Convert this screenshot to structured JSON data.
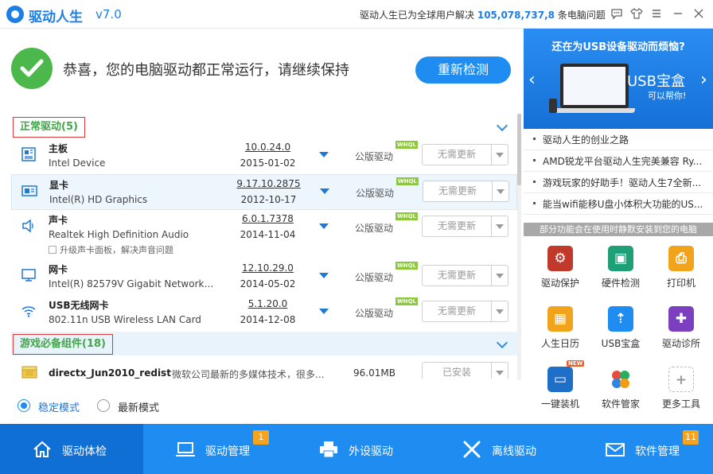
{
  "app": {
    "name": "驱动人生",
    "version": "v7.0",
    "stat_prefix": "驱动人生已为全球用户解决",
    "stat_count": "105,078,737,8",
    "stat_suffix": "条电脑问题"
  },
  "status": {
    "message": "恭喜，您的电脑驱动都正常运行，请继续保持",
    "recheck_label": "重新检测"
  },
  "sections": {
    "normal_title": "正常驱动(5)",
    "game_title": "游戏必备组件(18)"
  },
  "drivers": [
    {
      "name": "主板",
      "device": "Intel Device",
      "version": "10.0.24.0",
      "date": "2015-01-02",
      "type": "公版驱动",
      "certified": "WHQL",
      "action": "无需更新"
    },
    {
      "name": "显卡",
      "device": "Intel(R) HD Graphics",
      "version": "9.17.10.2875",
      "date": "2012-10-17",
      "type": "公版驱动",
      "certified": "WHQL",
      "action": "无需更新"
    },
    {
      "name": "声卡",
      "device": "Realtek High Definition Audio",
      "version": "6.0.1.7378",
      "date": "2014-11-04",
      "type": "公版驱动",
      "certified": "WHQL",
      "action": "无需更新",
      "extra": "升级声卡面板，解决声音问题"
    },
    {
      "name": "网卡",
      "device": "Intel(R) 82579V Gigabit Network ...",
      "version": "12.10.29.0",
      "date": "2014-05-02",
      "type": "公版驱动",
      "certified": "WHQL",
      "action": "无需更新"
    },
    {
      "name": "USB无线网卡",
      "device": "802.11n USB Wireless LAN Card",
      "version": "5.1.20.0",
      "date": "2014-12-08",
      "type": "公版驱动",
      "certified": "WHQL",
      "action": "无需更新"
    }
  ],
  "components": [
    {
      "name": "directx_Jun2010_redist",
      "description": "微软公司最新的多媒体技术，很多...",
      "size": "96.01MB",
      "action": "已安装"
    }
  ],
  "modes": {
    "stable": "稳定模式",
    "latest": "最新模式",
    "selected": "stable"
  },
  "banner": {
    "title": "还在为USB设备驱动而烦恼?",
    "main": "USB宝盒",
    "sub": "可以帮你!"
  },
  "news": [
    "驱动人生的创业之路",
    "AMD锐龙平台驱动人生完美兼容 Ry...",
    "游戏玩家的好助手！驱动人生7全新...",
    "能当wifi能移U盘小体积大功能的US..."
  ],
  "notice": "部分功能会在使用时静默安装到您的电脑",
  "tools": [
    {
      "label": "驱动保护",
      "icon": "shield-gear-icon",
      "color": "#c0392b"
    },
    {
      "label": "硬件检测",
      "icon": "monitor-check-icon",
      "color": "#1e9f76"
    },
    {
      "label": "打印机",
      "icon": "printer-icon",
      "color": "#f2a31c"
    },
    {
      "label": "人生日历",
      "icon": "calendar-icon",
      "color": "#f2a31c"
    },
    {
      "label": "USB宝盒",
      "icon": "usb-icon",
      "color": "#1e8cf0"
    },
    {
      "label": "驱动诊所",
      "icon": "doctor-icon",
      "color": "#7b3fbf"
    },
    {
      "label": "一键装机",
      "icon": "install-icon",
      "color": "#1e6fc8",
      "badge": "NEW"
    },
    {
      "label": "软件管家",
      "icon": "software-icon",
      "color": "#ffffff"
    },
    {
      "label": "更多工具",
      "icon": "plus-icon",
      "color": "#ffffff"
    }
  ],
  "nav": [
    {
      "label": "驱动体检",
      "icon": "home-icon"
    },
    {
      "label": "驱动管理",
      "icon": "laptop-icon",
      "badge": "1"
    },
    {
      "label": "外设驱动",
      "icon": "printer-icon"
    },
    {
      "label": "离线驱动",
      "icon": "tools-icon"
    },
    {
      "label": "软件管理",
      "icon": "mail-icon",
      "badge": "11"
    }
  ],
  "colors": {
    "brand_blue": "#1e8cf0",
    "active_nav": "#0f6fd5",
    "success_green": "#4cb84b",
    "section_text": "#44a54a",
    "highlight_border": "#d63a3a",
    "badge_orange": "#f7a31c"
  }
}
